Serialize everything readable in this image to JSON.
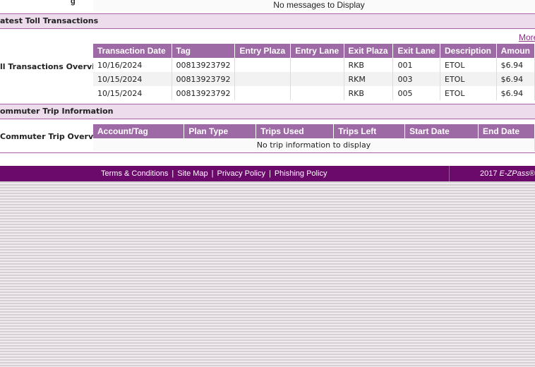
{
  "messages": {
    "label_fragment": "g",
    "empty_text": "No messages to Display"
  },
  "toll_section": {
    "title": "atest Toll Transactions",
    "more_link": "More",
    "overview_label": "ll Transactions Overview:",
    "columns": [
      "Transaction Date",
      "Tag",
      "Entry Plaza",
      "Entry Lane",
      "Exit Plaza",
      "Exit Lane",
      "Description",
      "Amoun"
    ],
    "rows": [
      [
        "10/16/2024",
        "00813923792",
        "",
        "",
        "RKB",
        "001",
        "ETOL",
        "$6.94"
      ],
      [
        "10/15/2024",
        "00813923792",
        "",
        "",
        "RKM",
        "003",
        "ETOL",
        "$6.94"
      ],
      [
        "10/15/2024",
        "00813923792",
        "",
        "",
        "RKB",
        "005",
        "ETOL",
        "$6.94"
      ]
    ]
  },
  "commuter_section": {
    "title": "ommuter Trip Information",
    "overview_label": "Commuter Trip Overview:",
    "columns": [
      "Account/Tag",
      "Plan Type",
      "Trips Used",
      "Trips Left",
      "Start Date",
      "End Date"
    ],
    "empty_text": "No trip information to display"
  },
  "footer": {
    "links": [
      "Terms & Conditions",
      "Site Map",
      "Privacy Policy",
      "Phishing Policy"
    ],
    "separator": "|",
    "copyright_prefix": "2017 ",
    "copyright_brand": "E-ZPass",
    "copyright_suffix": "® N"
  },
  "colors": {
    "header_purple": "#9e6aa6",
    "footer_purple": "#6b0a6b",
    "section_bg": "#ecdcec"
  }
}
